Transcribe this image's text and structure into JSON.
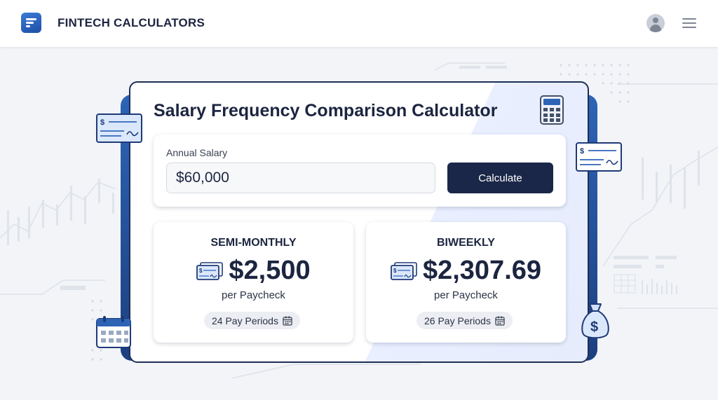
{
  "header": {
    "app_title": "FINTECH CALCULATORS"
  },
  "calculator": {
    "title": "Salary Frequency Comparison Calculator",
    "input_label": "Annual Salary",
    "input_value": "$60,000",
    "calculate_label": "Calculate"
  },
  "results": [
    {
      "heading": "SEMI-MONTHLY",
      "amount": "$2,500",
      "per_label": "per Paycheck",
      "periods_label": "24 Pay Periods"
    },
    {
      "heading": "BIWEEKLY",
      "amount": "$2,307.69",
      "per_label": "per Paycheck",
      "periods_label": "26 Pay Periods"
    }
  ],
  "icons": {
    "logo": "app-logo",
    "profile": "user-avatar-icon",
    "menu": "hamburger-menu-icon",
    "calculator": "calculator-icon",
    "check": "check-icon",
    "calendar": "calendar-icon",
    "money_bag": "money-bag-icon"
  },
  "colors": {
    "primary_dark": "#1b2748",
    "accent_blue": "#2d64b6",
    "background": "#f2f4f8"
  }
}
